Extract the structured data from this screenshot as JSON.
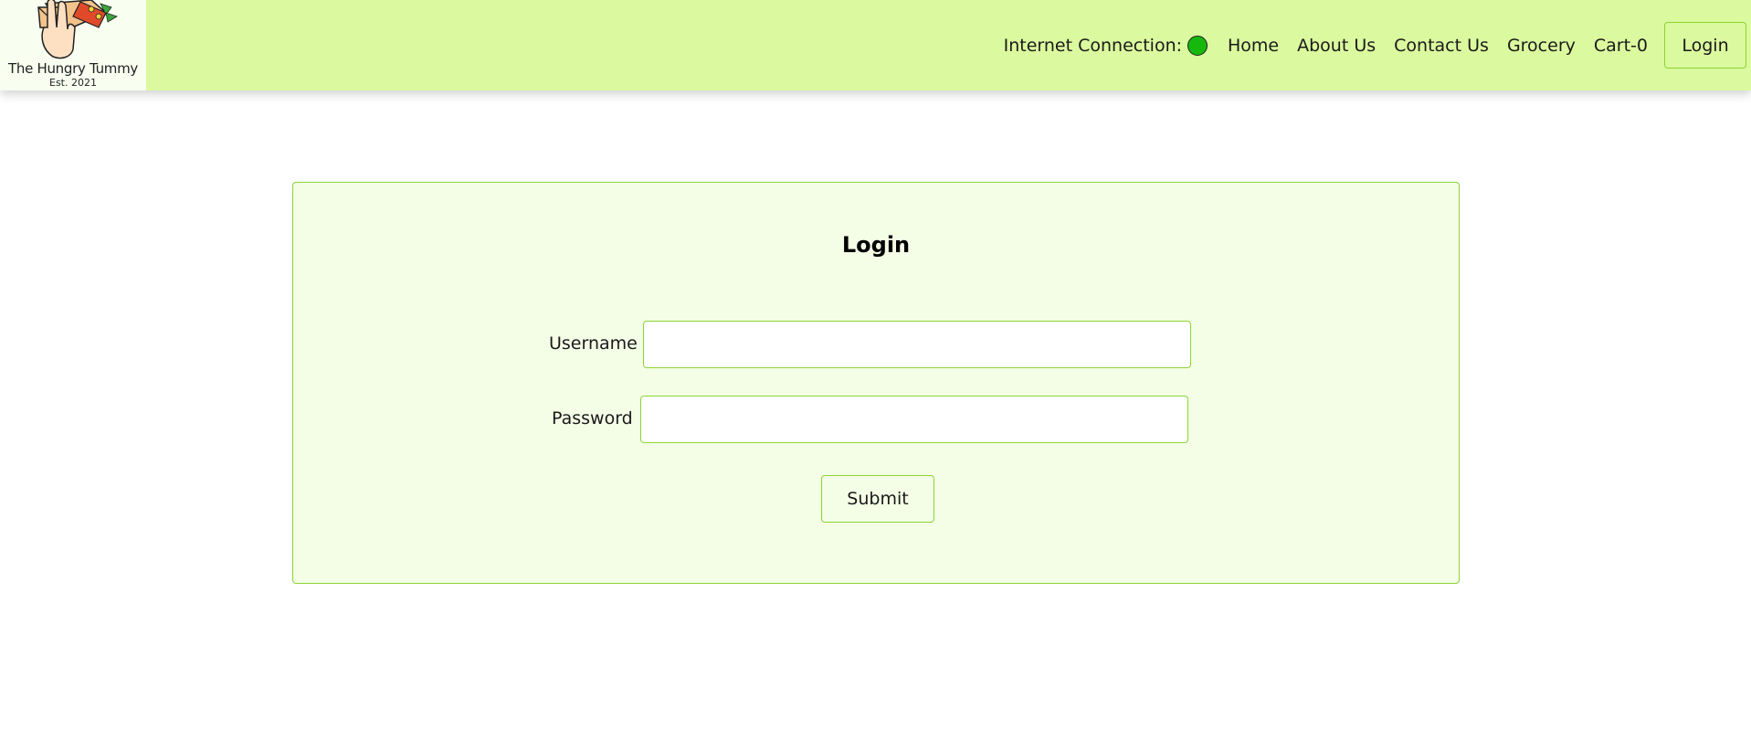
{
  "brand": {
    "name": "The Hungry Tummy",
    "tagline": "Est. 2021"
  },
  "nav": {
    "status_label": "Internet Connection:",
    "status_color": "#16b80e",
    "links": [
      "Home",
      "About Us",
      "Contact Us",
      "Grocery",
      "Cart-0"
    ],
    "login_label": "Login"
  },
  "form": {
    "title": "Login",
    "username_label": "Username",
    "username_value": "",
    "password_label": "Password",
    "password_value": "",
    "submit_label": "Submit"
  },
  "colors": {
    "header_bg": "#dbf99e",
    "accent_border": "#8bd433",
    "card_bg": "#f4fde6"
  }
}
